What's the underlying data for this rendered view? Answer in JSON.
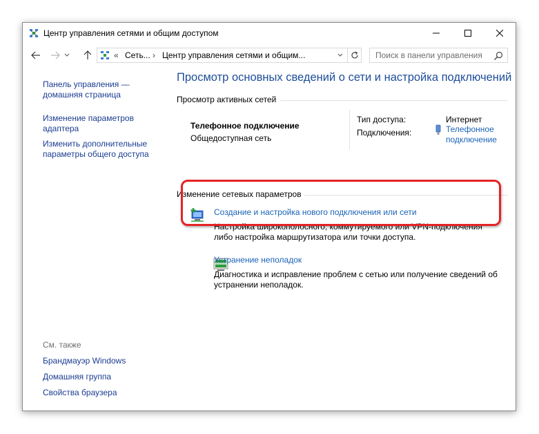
{
  "window": {
    "title": "Центр управления сетями и общим доступом"
  },
  "address": {
    "left_quotes": "«",
    "crumb1": "Сеть...",
    "separator": "›",
    "crumb2": "Центр управления сетями и общим..."
  },
  "search": {
    "placeholder": "Поиск в панели управления"
  },
  "sidebar": {
    "home_link": "Панель управления —\nдомашняя страница",
    "items": [
      {
        "label": "Изменение параметров\nадаптера"
      },
      {
        "label": "Изменить дополнительные\nпараметры общего доступа"
      }
    ],
    "see_also_label": "См. также",
    "see_also": [
      {
        "label": "Брандмауэр Windows"
      },
      {
        "label": "Домашняя группа"
      },
      {
        "label": "Свойства браузера"
      }
    ]
  },
  "main": {
    "title": "Просмотр основных сведений о сети и настройка подключений",
    "active_networks_title": "Просмотр активных сетей",
    "network": {
      "name": "Телефонное подключение",
      "category": "Общедоступная сеть",
      "access_type_label": "Тип доступа:",
      "access_type_value": "Интернет",
      "connections_label": "Подключения:",
      "connections_value": "Телефонное\nподключение"
    },
    "change_settings_title": "Изменение сетевых параметров",
    "tasks": [
      {
        "link": "Создание и настройка нового подключения или сети",
        "description": "Настройка широкополосного, коммутируемого или VPN-подключения\nлибо настройка маршрутизатора или точки доступа."
      },
      {
        "link": "Устранение неполадок",
        "description": "Диагностика и исправление проблем с сетью или получение сведений об\nустранении неполадок."
      }
    ]
  },
  "colors": {
    "link": "#1a63b8",
    "sidebar_link": "#1a3c91",
    "title": "#1e4e9a",
    "highlight": "#e52323"
  }
}
